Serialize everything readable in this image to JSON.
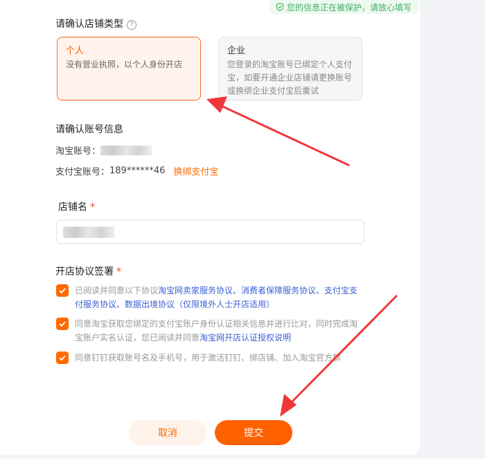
{
  "notice": {
    "text": "您的信息正在被保护，请放心填写",
    "icon": "shield-check-icon"
  },
  "store_type": {
    "title": "请确认店铺类型",
    "help_icon": "question-circle-icon",
    "options": [
      {
        "title": "个人",
        "desc": "没有营业执照，以个人身份开店",
        "selected": true
      },
      {
        "title": "企业",
        "desc": "您登录的淘宝账号已绑定个人支付宝，如要开通企业店铺请更换账号或换绑企业支付宝后重试",
        "selected": false
      }
    ]
  },
  "account": {
    "title": "请确认账号信息",
    "taobao_label": "淘宝账号：",
    "alipay_label": "支付宝账号：",
    "alipay_value": "189******46",
    "rebind_link": "换绑支付宝"
  },
  "store_name": {
    "label": "店铺名",
    "required_mark": "*"
  },
  "agreement": {
    "title": "开店协议签署",
    "required_mark": "*",
    "items": [
      {
        "checked": true,
        "parts": [
          {
            "text": "已阅读并同意以下协议",
            "link": false
          },
          {
            "text": "淘宝网卖家服务协议、消费者保障服务协议、支付宝支付服务协议、数据出境协议（仅限境外人士开店适用）",
            "link": true
          }
        ]
      },
      {
        "checked": true,
        "parts": [
          {
            "text": "同意淘宝获取您绑定的支付宝账户身份认证相关信息并进行比对，同时完成淘宝账户实名认证，您已阅读并同意",
            "link": false
          },
          {
            "text": "淘宝网开店认证授权说明",
            "link": true
          }
        ]
      },
      {
        "checked": true,
        "parts": [
          {
            "text": "同意钉钉获取账号名及手机号，用于激活钉钉、绑店铺、加入淘宝官方群",
            "link": false
          }
        ]
      }
    ]
  },
  "buttons": {
    "cancel": "取消",
    "submit": "提交"
  },
  "colors": {
    "accent": "#ff6a00",
    "link": "#3b5fd6",
    "safe": "#3fae62",
    "arrow": "#f0383a"
  }
}
